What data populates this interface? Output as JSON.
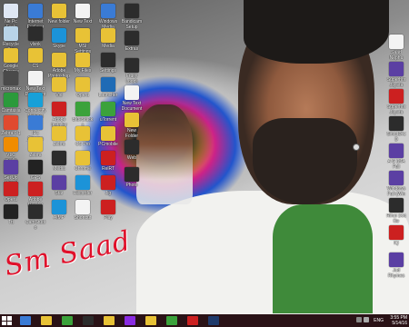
{
  "desktop": {
    "signature_text": "Sm Saad",
    "icons_left": [
      {
        "label": "Ne Pc Fusk",
        "color": "#dfe7f4"
      },
      {
        "label": "Recycle Bin",
        "color": "#b9d4e8"
      },
      {
        "label": "Google Chrome",
        "color": "#e8c236"
      },
      {
        "label": "micromax",
        "color": "#4a4a4a"
      },
      {
        "label": "Camtasia",
        "color": "#2b9a3b"
      },
      {
        "label": "Zebra 0 1",
        "color": "#e04a2f"
      },
      {
        "label": "VLC media player",
        "color": "#f08c00"
      },
      {
        "label": "Set Up Wizard",
        "color": "#5b3fa3"
      },
      {
        "label": "Opera",
        "color": "#cc2020"
      },
      {
        "label": "Ttt",
        "color": "#222222"
      }
    ],
    "icons_col2": [
      {
        "label": "Internet Explorer",
        "color": "#3a7bd5"
      },
      {
        "label": "vlsnk",
        "color": "#2c2c2c"
      },
      {
        "label": "CS",
        "color": "#e8c236"
      },
      {
        "label": "New Text Document",
        "color": "#f3f3f3"
      },
      {
        "label": "Connectify Hotspot",
        "color": "#18a0d8"
      },
      {
        "label": "IFC Cinema Launcher",
        "color": "#3a7bd5"
      },
      {
        "label": "Zebra",
        "color": "#e8c236"
      },
      {
        "label": "GPS",
        "color": "#222222"
      },
      {
        "label": "Adobe Reader",
        "color": "#cc2020"
      },
      {
        "label": "CamStudio",
        "color": "#2c2c2c"
      }
    ],
    "icons_col3": [
      {
        "label": "New folder",
        "color": "#e8c236"
      },
      {
        "label": "Skype",
        "color": "#1c93d8"
      },
      {
        "label": "Adobe Photoshop",
        "color": "#e8c236"
      },
      {
        "label": "Vid",
        "color": "#e8c236"
      },
      {
        "label": "Adobe Installer",
        "color": "#cc2020"
      },
      {
        "label": "Zebra",
        "color": "#e8c236"
      },
      {
        "label": "Media",
        "color": "#2c2c2c"
      },
      {
        "label": "Star",
        "color": "#5b3fa3"
      },
      {
        "label": "AIMP",
        "color": "#1c93d8"
      }
    ],
    "icons_col4": [
      {
        "label": "New Text",
        "color": "#f3f3f3"
      },
      {
        "label": "MSI Settings",
        "color": "#e8c236"
      },
      {
        "label": "My Files",
        "color": "#e8c236"
      },
      {
        "label": "Opera",
        "color": "#e8c236"
      },
      {
        "label": "BlueStacks",
        "color": "#3ba23b"
      },
      {
        "label": "CS Pro",
        "color": "#e8c236"
      },
      {
        "label": "Chrome",
        "color": "#e8c236"
      },
      {
        "label": "Recorder",
        "color": "#1c93d8"
      },
      {
        "label": "Shortcut",
        "color": "#f3f3f3"
      }
    ],
    "icons_col5": [
      {
        "label": "Windows Media Setup",
        "color": "#3a7bd5"
      },
      {
        "label": "Media",
        "color": "#e8c236"
      },
      {
        "label": "Settings",
        "color": "#2c2c2c"
      },
      {
        "label": "Launcher",
        "color": "#1f6bb5"
      },
      {
        "label": "uTorrent",
        "color": "#3ba23b"
      },
      {
        "label": "PCmobile",
        "color": "#e8c236"
      },
      {
        "label": "RelRT",
        "color": "#cc2020"
      },
      {
        "label": "Jig",
        "color": "#cc2020"
      },
      {
        "label": "Play",
        "color": "#cc2020"
      }
    ],
    "icons_col6": [
      {
        "label": "Bandicam Setup",
        "color": "#2c2c2c"
      },
      {
        "label": "Extras",
        "color": "#2c2c2c"
      },
      {
        "label": "Fruity Loops",
        "color": "#2c2c2c"
      },
      {
        "label": "New Text Document",
        "color": "#f3f3f3"
      },
      {
        "label": "New Folder",
        "color": "#e8c236"
      },
      {
        "label": "Web",
        "color": "#2c2c2c"
      },
      {
        "label": "Photo",
        "color": "#2c2c2c"
      }
    ],
    "icons_right": [
      {
        "label": "Saad Nephu",
        "color": "#f3f3f3"
      },
      {
        "label": "Superhot Jayeta",
        "color": "#5b3fa3"
      },
      {
        "label": "Superhot Jayeta",
        "color": "#cc2020"
      },
      {
        "label": "SinodDiCD",
        "color": "#2c2c2c"
      },
      {
        "label": "A G (MA Full",
        "color": "#5b3fa3"
      },
      {
        "label": "Windows Full (Win",
        "color": "#5b3fa3"
      },
      {
        "label": "Rihai Doc file",
        "color": "#2c2c2c"
      },
      {
        "label": "IQ",
        "color": "#cc2020"
      },
      {
        "label": "Jud Rhymes",
        "color": "#5b3fa3"
      }
    ]
  },
  "taskbar": {
    "items": [
      {
        "name": "ie-taskbar-icon",
        "color": "#3a7bd5"
      },
      {
        "name": "explorer-taskbar-icon",
        "color": "#e8c236"
      },
      {
        "name": "store-taskbar-icon",
        "color": "#3ba23b"
      },
      {
        "name": "media-taskbar-icon",
        "color": "#2c2c2c"
      },
      {
        "name": "chrome-taskbar-icon",
        "color": "#e8c236"
      },
      {
        "name": "app-taskbar-icon",
        "color": "#8a2be2"
      },
      {
        "name": "files-taskbar-icon",
        "color": "#e8c236"
      },
      {
        "name": "camtasia-taskbar-icon",
        "color": "#3ba23b"
      },
      {
        "name": "recorder-taskbar-icon",
        "color": "#cc2020"
      },
      {
        "name": "photoshop-taskbar-icon",
        "color": "#1f3a6b"
      }
    ],
    "language": "ENG",
    "time": "3:55 PM",
    "date": "5/14/16"
  }
}
